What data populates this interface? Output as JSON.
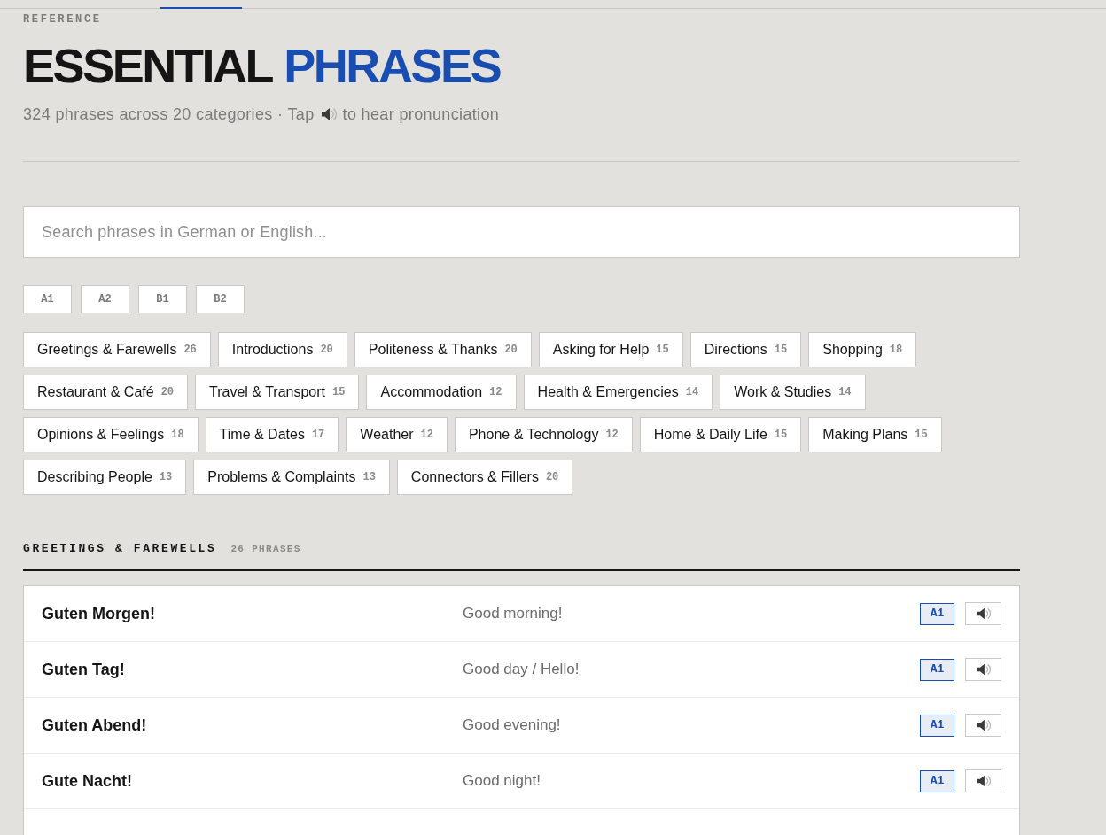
{
  "header": {
    "eyebrow": "REFERENCE",
    "title": {
      "main": "ESSENTIAL",
      "accent": "PHRASES"
    },
    "subtitle": {
      "before": "324 phrases across 20 categories · Tap",
      "after": "to hear pronunciation"
    }
  },
  "search": {
    "placeholder": "Search phrases in German or English..."
  },
  "level_filters": [
    {
      "label": "A1",
      "selected": false
    },
    {
      "label": "A2",
      "selected": false
    },
    {
      "label": "B1",
      "selected": false
    },
    {
      "label": "B2",
      "selected": false
    }
  ],
  "categories": [
    {
      "label": "Greetings & Farewells",
      "count": "26",
      "selected": false
    },
    {
      "label": "Introductions",
      "count": "20",
      "selected": false
    },
    {
      "label": "Politeness & Thanks",
      "count": "20",
      "selected": false
    },
    {
      "label": "Asking for Help",
      "count": "15",
      "selected": false
    },
    {
      "label": "Directions",
      "count": "15",
      "selected": false
    },
    {
      "label": "Shopping",
      "count": "18",
      "selected": false
    },
    {
      "label": "Restaurant & Café",
      "count": "20",
      "selected": false
    },
    {
      "label": "Travel & Transport",
      "count": "15",
      "selected": false
    },
    {
      "label": "Accommodation",
      "count": "12",
      "selected": false
    },
    {
      "label": "Health & Emergencies",
      "count": "14",
      "selected": false
    },
    {
      "label": "Work & Studies",
      "count": "14",
      "selected": false
    },
    {
      "label": "Opinions & Feelings",
      "count": "18",
      "selected": false
    },
    {
      "label": "Time & Dates",
      "count": "17",
      "selected": false
    },
    {
      "label": "Weather",
      "count": "12",
      "selected": false
    },
    {
      "label": "Phone & Technology",
      "count": "12",
      "selected": false
    },
    {
      "label": "Home & Daily Life",
      "count": "15",
      "selected": false
    },
    {
      "label": "Making Plans",
      "count": "15",
      "selected": false
    },
    {
      "label": "Describing People",
      "count": "13",
      "selected": false
    },
    {
      "label": "Problems & Complaints",
      "count": "13",
      "selected": false
    },
    {
      "label": "Connectors & Fillers",
      "count": "20",
      "selected": false
    }
  ],
  "section": {
    "title": "GREETINGS & FAREWELLS",
    "count": "26 PHRASES"
  },
  "phrases": [
    {
      "german": "Guten Morgen!",
      "english": "Good morning!",
      "badge": "A1"
    },
    {
      "german": "Guten Tag!",
      "english": "Good day / Hello!",
      "badge": "A1"
    },
    {
      "german": "Guten Abend!",
      "english": "Good evening!",
      "badge": "A1"
    },
    {
      "german": "Gute Nacht!",
      "english": "Good night!",
      "badge": "A1"
    }
  ]
}
